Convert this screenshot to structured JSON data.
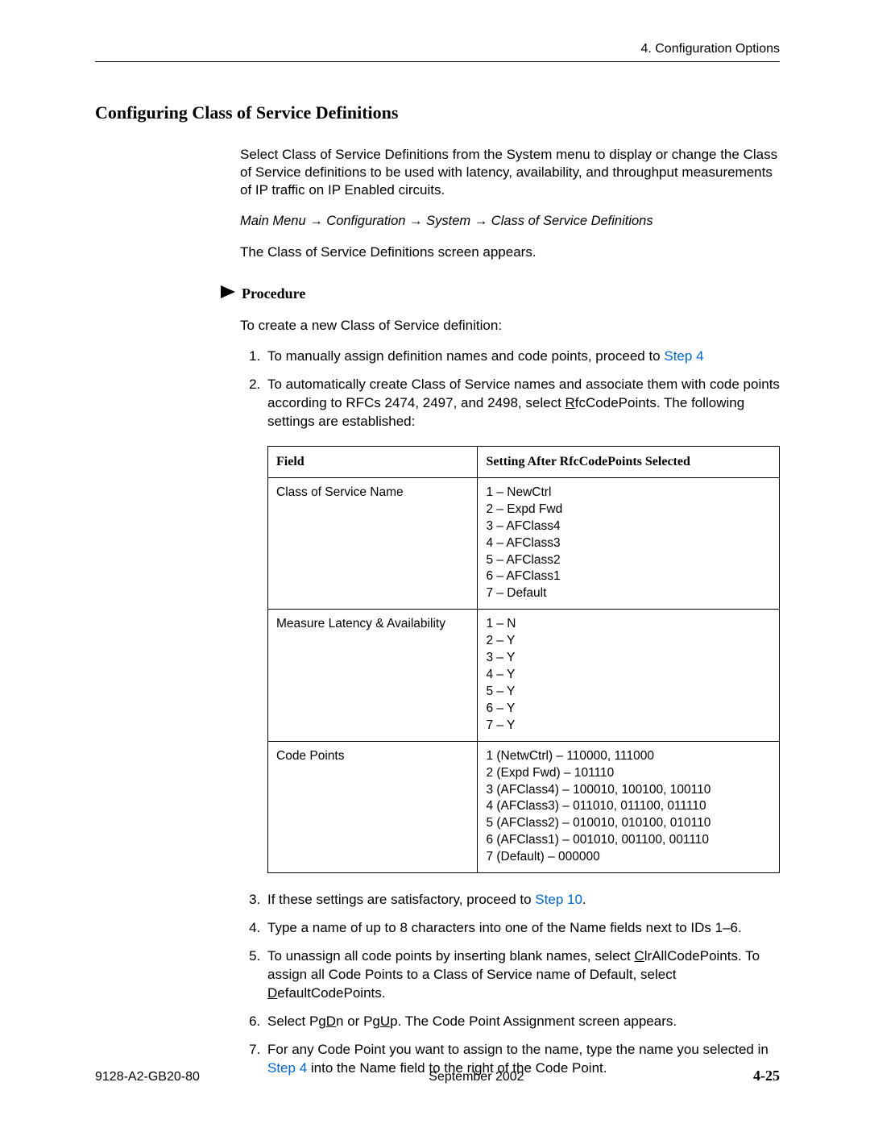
{
  "header": {
    "chapter_label": "4. Configuration Options"
  },
  "title": "Configuring Class of Service Definitions",
  "intro_para": "Select Class of Service Definitions from the System menu to display or change the Class of Service definitions to be used with latency, availability, and throughput measurements of IP traffic on IP Enabled circuits.",
  "breadcrumb": "Main Menu → Configuration → System → Class of Service Definitions",
  "after_breadcrumb": "The Class of Service Definitions screen appears.",
  "procedure_label": "Procedure",
  "procedure_intro": "To create a new Class of Service definition:",
  "steps": {
    "s1_pre": "To manually assign definition names and code points, proceed to ",
    "s1_link": "Step 4",
    "s2_pre": "To automatically create Class of Service names and associate them with code points according to RFCs 2474, 2497, and 2498, select ",
    "s2_u": "R",
    "s2_after_u": "fcCodePoints. The following settings are established:",
    "s3_pre": "If these settings are satisfactory, proceed to ",
    "s3_link": "Step 10",
    "s3_post": ".",
    "s4": "Type a name of up to 8 characters into one of the Name fields next to IDs 1–6.",
    "s5_pre": "To unassign all code points by inserting blank names, select ",
    "s5_u1": "C",
    "s5_mid1": "lrAllCodePoints. To assign all Code Points to a Class of Service name of Default, select ",
    "s5_u2": "D",
    "s5_mid2": "efaultCodePoints.",
    "s6_pre": "Select Pg",
    "s6_u1": "D",
    "s6_mid": "n or Pg",
    "s6_u2": "U",
    "s6_post": "p. The Code Point Assignment screen appears.",
    "s7_pre": "For any Code Point you want to assign to the name, type the name you selected in ",
    "s7_link": "Step 4",
    "s7_post": " into the Name field to the right of the Code Point."
  },
  "table": {
    "head_field": "Field",
    "head_setting": "Setting After RfcCodePoints Selected",
    "r1_field": "Class of Service Name",
    "r1_setting": "1 – NewCtrl\n2 – Expd Fwd\n3 – AFClass4\n4 – AFClass3\n5 – AFClass2\n6 – AFClass1\n7 – Default",
    "r2_field": "Measure Latency & Availability",
    "r2_setting": "1 – N\n2 – Y\n3 – Y\n4 – Y\n5 – Y\n6 – Y\n7 – Y",
    "r3_field": "Code Points",
    "r3_setting": "1 (NetwCtrl)  – 110000, 111000\n2 (Expd Fwd) – 101110\n3 (AFClass4) – 100010, 100100, 100110\n4 (AFClass3) –  011010, 011100, 011110\n5 (AFClass2) –  010010, 010100, 010110\n6 (AFClass1) –  001010, 001100, 001110\n7 (Default)     –  000000"
  },
  "footer": {
    "docnum": "9128-A2-GB20-80",
    "date": "September 2002",
    "page": "4-25"
  }
}
